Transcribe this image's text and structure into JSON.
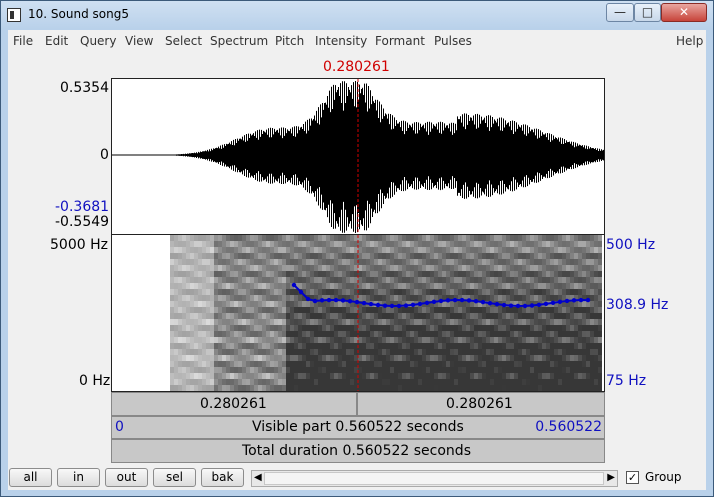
{
  "window": {
    "title": "10. Sound song5"
  },
  "menu": [
    "File",
    "Edit",
    "Query",
    "View",
    "Select",
    "Spectrum",
    "Pitch",
    "Intensity",
    "Formant",
    "Pulses"
  ],
  "menu_help": "Help",
  "cursor": {
    "time_label": "0.280261"
  },
  "waveform": {
    "ymax": "0.5354",
    "zero": "0",
    "cursor_val": "-0.3681",
    "ymin": "-0.5549"
  },
  "spectrogram": {
    "fmax": "5000 Hz",
    "fmin": "0 Hz",
    "pitch_max": "500 Hz",
    "pitch_cursor": "308.9 Hz",
    "pitch_min": "75 Hz"
  },
  "time_strip": {
    "left": "0.280261",
    "right": "0.280261"
  },
  "visible": {
    "start": "0",
    "text": "Visible part 0.560522 seconds",
    "end": "0.560522"
  },
  "total": {
    "text": "Total duration 0.560522 seconds"
  },
  "buttons": {
    "all": "all",
    "in": "in",
    "out": "out",
    "sel": "sel",
    "bak": "bak"
  },
  "group": {
    "label": "Group",
    "checked": true
  },
  "colors": {
    "cursor": "#d00000",
    "pitch": "#0000cc",
    "accent_text": "#1010c0"
  }
}
